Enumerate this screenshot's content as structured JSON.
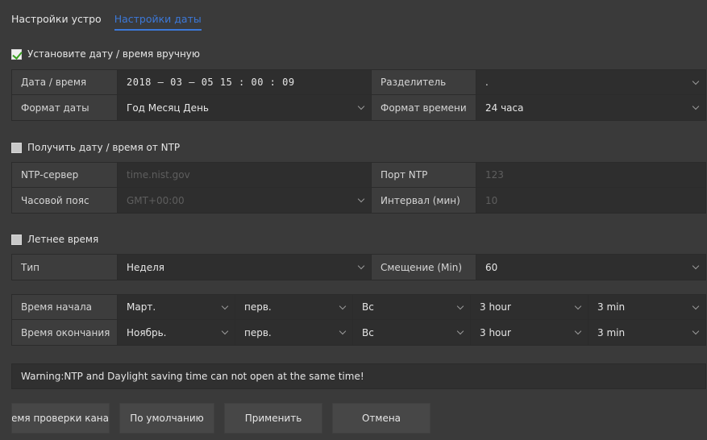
{
  "tabs": [
    {
      "label": "Настройки устро",
      "active": false
    },
    {
      "label": "Настройки даты",
      "active": true
    }
  ],
  "manual": {
    "label": "Установите дату / время вручную",
    "checked": true,
    "datetime_label": "Дата / время",
    "date_value": "2018  –  03  –  05      15 : 00 : 09",
    "separator_label": "Разделитель",
    "separator_value": ".",
    "date_format_label": "Формат даты",
    "date_format_value": "Год Месяц День",
    "time_format_label": "Формат времени",
    "time_format_value": "24 часа"
  },
  "ntp": {
    "label": "Получить дату / время от NTP",
    "checked": false,
    "server_label": "NTP-сервер",
    "server_value": "time.nist.gov",
    "port_label": "Порт NTP",
    "port_value": "123",
    "timezone_label": "Часовой пояс",
    "timezone_value": "GMT+00:00",
    "interval_label": "Интервал (мин)",
    "interval_value": "10"
  },
  "dst": {
    "label": "Летнее время",
    "checked": false,
    "type_label": "Тип",
    "type_value": "Неделя",
    "offset_label": "Смещение (Min)",
    "offset_value": "60",
    "start_label": "Время начала",
    "start": {
      "month": "Март.",
      "week": "перв.",
      "day": "Вс",
      "hour": "3 hour",
      "min": "3 min"
    },
    "end_label": "Время окончания",
    "end": {
      "month": "Ноябрь.",
      "week": "перв.",
      "day": "Вс",
      "hour": "3 hour",
      "min": "3 min"
    }
  },
  "warning": "Warning:NTP and Daylight saving time can not open at the same time!",
  "buttons": {
    "check": "ремя проверки кана",
    "default": "По умолчанию",
    "apply": "Применить",
    "cancel": "Отмена"
  },
  "colors": {
    "accent": "#3c78d8",
    "background": "#3a3a3a",
    "check": "#38a020"
  }
}
